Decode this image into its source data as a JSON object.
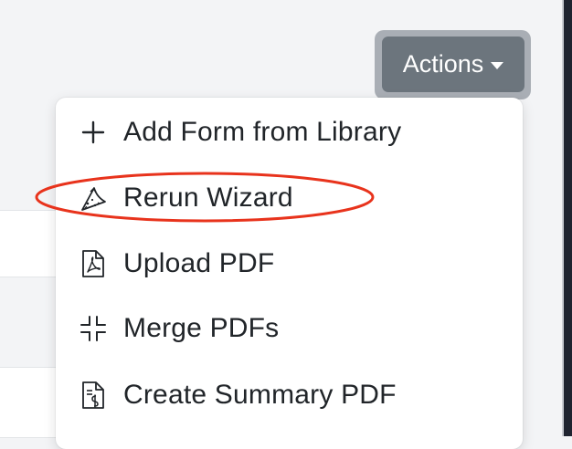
{
  "actions_button": {
    "label": "Actions"
  },
  "menu": {
    "items": [
      {
        "label": "Add Form from Library",
        "icon": "plus-icon"
      },
      {
        "label": "Rerun Wizard",
        "icon": "magic-wand-icon"
      },
      {
        "label": "Upload PDF",
        "icon": "pdf-file-icon"
      },
      {
        "label": "Merge PDFs",
        "icon": "merge-icon"
      },
      {
        "label": "Create Summary PDF",
        "icon": "summary-file-icon"
      }
    ]
  },
  "annotation": {
    "color": "#e8331c",
    "shape": "ellipse",
    "target": "Rerun Wizard"
  },
  "colors": {
    "button_bg": "#6c757d",
    "button_focus_ring": "#a9aeb5",
    "page_bg": "#f3f4f6",
    "text": "#212529"
  }
}
